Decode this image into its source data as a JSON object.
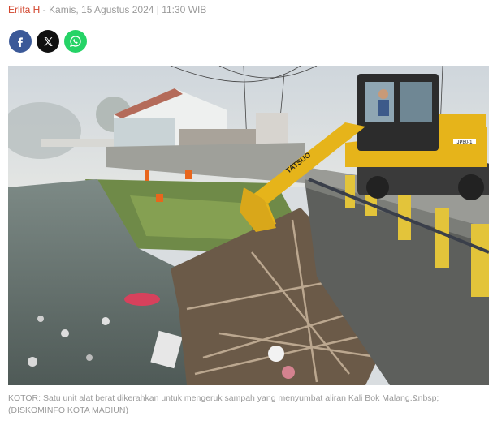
{
  "byline": {
    "author": "Erlita H",
    "separator": " - ",
    "datetime": "Kamis, 15 Agustus 2024 | 11:30 WIB"
  },
  "share": {
    "buttons": [
      {
        "icon": "facebook-icon",
        "color": "#3b5998"
      },
      {
        "icon": "x-icon",
        "color": "#111111"
      },
      {
        "icon": "whatsapp-icon",
        "color": "#25d366"
      }
    ]
  },
  "photo": {
    "excavator_brand": "TATSUO",
    "excavator_model": "JP80-1"
  },
  "caption": {
    "line1": "KOTOR: Satu unit alat berat dikerahkan untuk mengeruk sampah yang menyumbat aliran Kali Bok Malang.&nbsp;",
    "line2": "(DISKOMINFO KOTA MADIUN)"
  }
}
